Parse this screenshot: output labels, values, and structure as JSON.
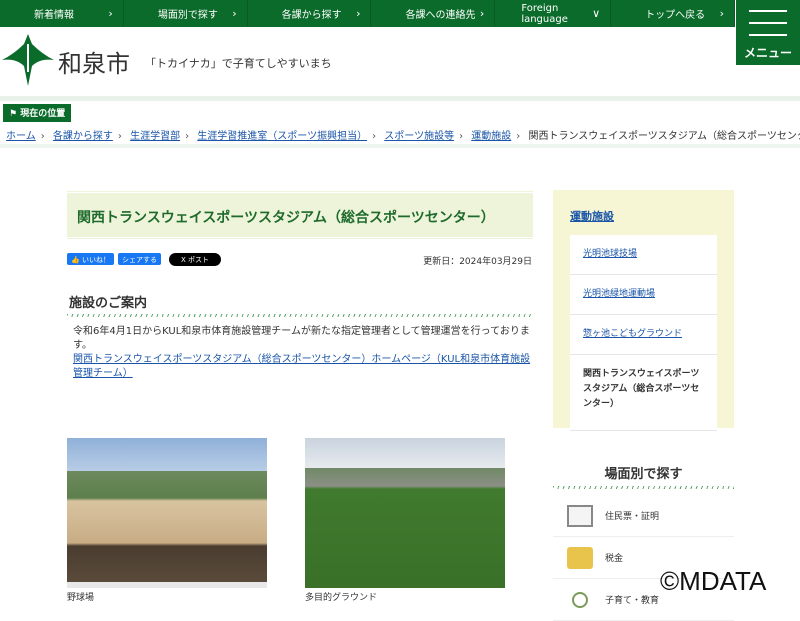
{
  "topnav": [
    {
      "label": "新着情報",
      "chevron": "›"
    },
    {
      "label": "場面別で探す",
      "chevron": "›"
    },
    {
      "label": "各課から探す",
      "chevron": "›"
    },
    {
      "label": "各課への連絡先",
      "chevron": "›"
    },
    {
      "label": "Foreign language",
      "chevron": "∨"
    },
    {
      "label": "トップへ戻る",
      "chevron": "›"
    }
  ],
  "menu_label": "メニュー",
  "header": {
    "city": "和泉市",
    "tagline": "「トカイナカ」で子育てしやすいまち"
  },
  "location_label": "現在の位置",
  "breadcrumb": [
    "ホーム",
    "各課から探す",
    "生涯学習部",
    "生涯学習推進室（スポーツ振興担当）",
    "スポーツ施設等",
    "運動施設"
  ],
  "breadcrumb_current": "関西トランスウェイスポーツスタジアム（総合スポーツセンター）",
  "page_title": "関西トランスウェイスポーツスタジアム（総合スポーツセンター）",
  "social": {
    "like": "いいね！",
    "share": "シェアする",
    "post": "X ポスト"
  },
  "updated": "更新日：2024年03月29日",
  "section_title": "施設のご案内",
  "body_text": "令和6年4月1日からKUL和泉市体育施設管理チームが新たな指定管理者として管理運営を行っております。",
  "body_link": "関西トランスウェイスポーツスタジアム（総合スポーツセンター）ホームページ（KUL和泉市体育施設管理チーム）",
  "photos": [
    {
      "caption": "野球場"
    },
    {
      "caption": "多目的グラウンド"
    }
  ],
  "sidebar": {
    "heading": "運動施設",
    "items": [
      "光明池球技場",
      "光明池緑地運動場",
      "惣ヶ池こどもグラウンド"
    ],
    "current": "関西トランスウェイスポーツスタジアム（総合スポーツセンター）"
  },
  "scene": {
    "heading": "場面別で探す",
    "items": [
      "住民票・証明",
      "税金",
      "子育て・教育"
    ]
  },
  "watermark": "©MDATA"
}
